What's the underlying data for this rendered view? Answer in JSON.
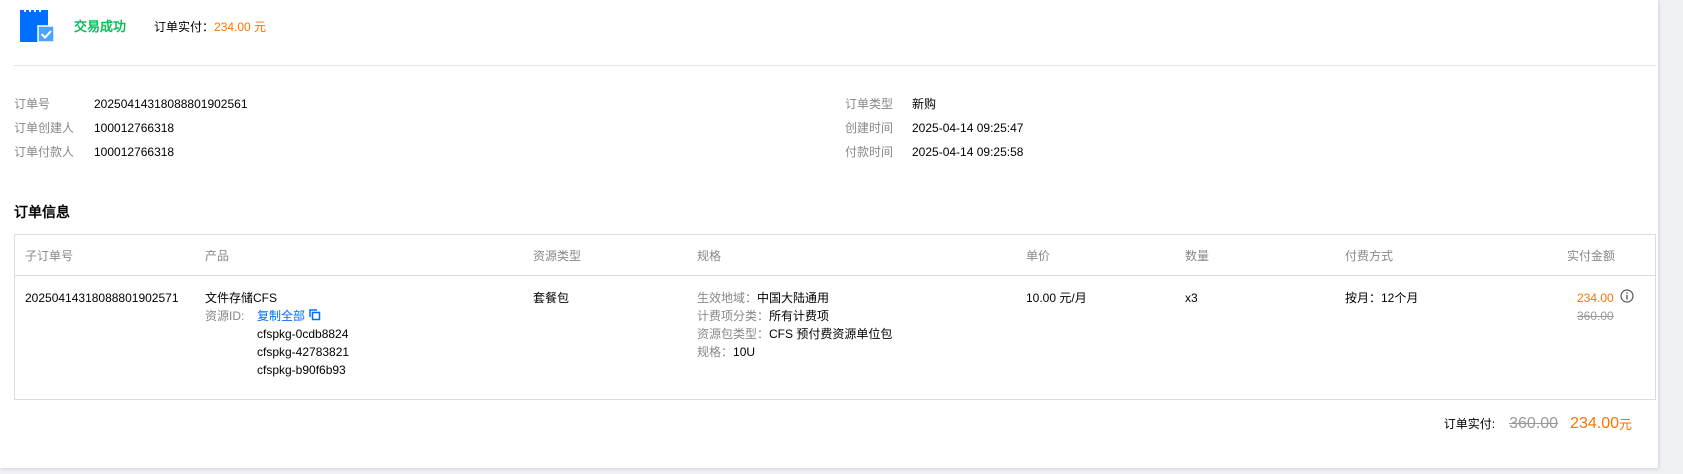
{
  "header": {
    "status": "交易成功",
    "paid_label": "订单实付：",
    "paid_value": "234.00 元"
  },
  "meta": {
    "left": [
      {
        "label": "订单号",
        "value": "20250414318088801902561"
      },
      {
        "label": "订单创建人",
        "value": "100012766318"
      },
      {
        "label": "订单付款人",
        "value": "100012766318"
      }
    ],
    "right": [
      {
        "label": "订单类型",
        "value": "新购"
      },
      {
        "label": "创建时间",
        "value": "2025-04-14 09:25:47"
      },
      {
        "label": "付款时间",
        "value": "2025-04-14 09:25:58"
      }
    ]
  },
  "section_title": "订单信息",
  "table": {
    "columns": [
      "子订单号",
      "产品",
      "资源类型",
      "规格",
      "单价",
      "数量",
      "付费方式",
      "实付金额"
    ],
    "rows": [
      {
        "sub_order_id": "20250414318088801902571",
        "product": "文件存储CFS",
        "resource_id_label": "资源ID:",
        "copy_all": "复制全部",
        "resource_ids": [
          "cfspkg-0cdb8824",
          "cfspkg-42783821",
          "cfspkg-b90f6b93"
        ],
        "resource_type": "套餐包",
        "specs": [
          {
            "label": "生效地域：",
            "value": "中国大陆通用"
          },
          {
            "label": "计费项分类：",
            "value": "所有计费项"
          },
          {
            "label": "资源包类型：",
            "value": "CFS 预付费资源单位包"
          },
          {
            "label": "规格：",
            "value": "10U"
          }
        ],
        "unit_price": "10.00 元/月",
        "quantity": "x3",
        "billing": "按月：12个月",
        "paid_amount": "234.00",
        "original_amount": "360.00"
      }
    ]
  },
  "total": {
    "label": "订单实付:",
    "original": "360.00",
    "final": "234.00",
    "unit": "元"
  },
  "colors": {
    "success": "#0abf5b",
    "accent": "#ff7200",
    "link": "#006eff",
    "icon_blue": "#006eff"
  },
  "icons": {
    "order": "order-success-icon",
    "copy": "copy-icon",
    "info": "info-icon"
  }
}
